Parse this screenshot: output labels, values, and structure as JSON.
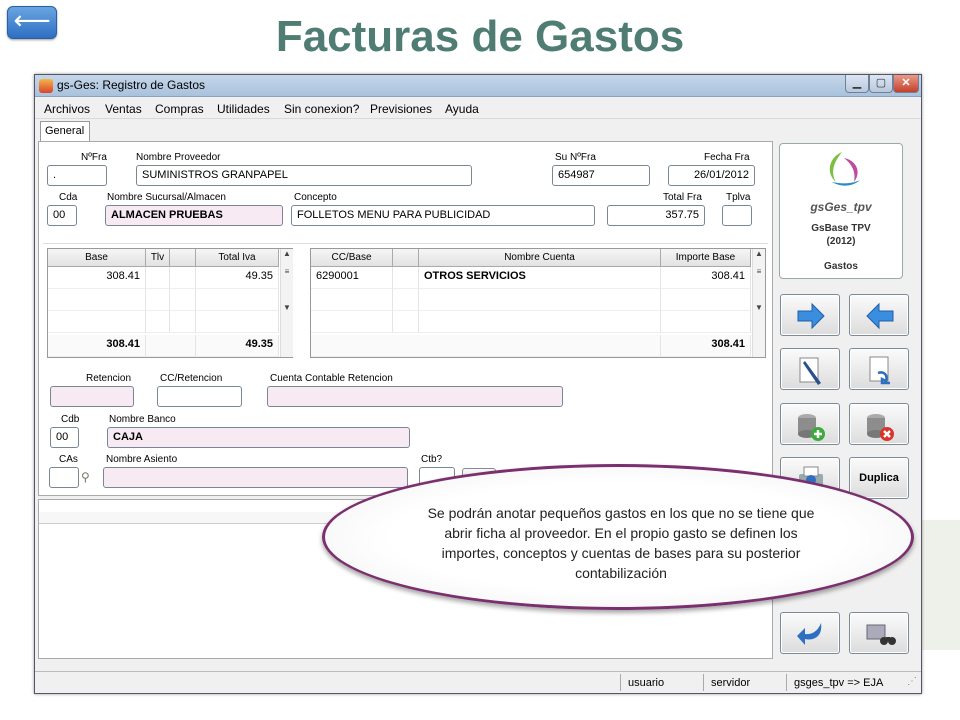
{
  "slide": {
    "title": "Facturas de Gastos",
    "back_label": "⟵"
  },
  "window": {
    "title": "gs-Ges: Registro de Gastos",
    "controls": {
      "minimize": "▁",
      "maximize": "▢",
      "close": "✕"
    }
  },
  "menu": [
    "Archivos",
    "Ventas",
    "Compras",
    "Utilidades",
    "Sin conexion?",
    "Previsiones",
    "Ayuda"
  ],
  "tab_label": "General",
  "header": {
    "nfra_label": "NºFra",
    "nfra_value": ".",
    "proveedor_label": "Nombre Proveedor",
    "proveedor_value": "SUMINISTROS GRANPAPEL",
    "sunfra_label": "Su NºFra",
    "sunfra_value": "654987",
    "fecha_label": "Fecha Fra",
    "fecha_value": "26/01/2012",
    "cda_label": "Cda",
    "cda_value": "00",
    "sucursal_label": "Nombre Sucursal/Almacen",
    "sucursal_value": "ALMACEN PRUEBAS",
    "concepto_label": "Concepto",
    "concepto_value": "FOLLETOS MENU PARA PUBLICIDAD",
    "total_label": "Total Fra",
    "total_value": "357.75",
    "tplva_label": "Tplva",
    "tplva_value": ""
  },
  "iva_grid": {
    "headers": [
      "Base",
      "Tlv",
      "",
      "Total Iva"
    ],
    "row1": {
      "base": "308.41",
      "total_iva": "49.35"
    },
    "totals": {
      "base": "308.41",
      "total_iva": "49.35"
    }
  },
  "cuentas_grid": {
    "headers": [
      "CC/Base",
      "",
      "Nombre Cuenta",
      "Importe Base"
    ],
    "row1": {
      "cc": "6290001",
      "nombre": "OTROS SERVICIOS",
      "importe": "308.41"
    },
    "total": "308.41"
  },
  "retencion": {
    "retencion_label": "Retencion",
    "cc_label": "CC/Retencion",
    "cuenta_label": "Cuenta Contable Retencion"
  },
  "banco": {
    "cdb_label": "Cdb",
    "cdb_value": "00",
    "nombre_label": "Nombre Banco",
    "nombre_value": "CAJA"
  },
  "asiento": {
    "cas_label": "CAs",
    "nombre_label": "Nombre Asiento",
    "ctb_label": "Ctb?"
  },
  "logo": {
    "brand": "gsGes_tpv",
    "product": "GsBase TPV",
    "year": "(2012)",
    "section": "Gastos"
  },
  "side_buttons": {
    "next_icon": "arrow-right-icon",
    "prev_icon": "arrow-left-icon",
    "edit_icon": "pencil-document-icon",
    "undo_icon": "document-undo-icon",
    "add_icon": "database-add-icon",
    "delete_icon": "database-delete-icon",
    "print_icon": "printer-icon",
    "duplica_label": "Duplica",
    "return_icon": "return-arrow-icon",
    "search_icon": "binoculars-icon"
  },
  "status": {
    "user": "usuario",
    "server": "servidor",
    "db": "gsges_tpv => EJA"
  },
  "callout": "Se podrán anotar pequeños gastos en los que no se tiene que abrir ficha al proveedor. En el propio gasto se definen los importes, conceptos y cuentas de bases para su posterior contabilización",
  "colors": {
    "title": "#4f7c73",
    "accent_blue": "#2e6fc2",
    "callout_border": "#7a2f6e",
    "field_pink": "#f7eaf2"
  }
}
